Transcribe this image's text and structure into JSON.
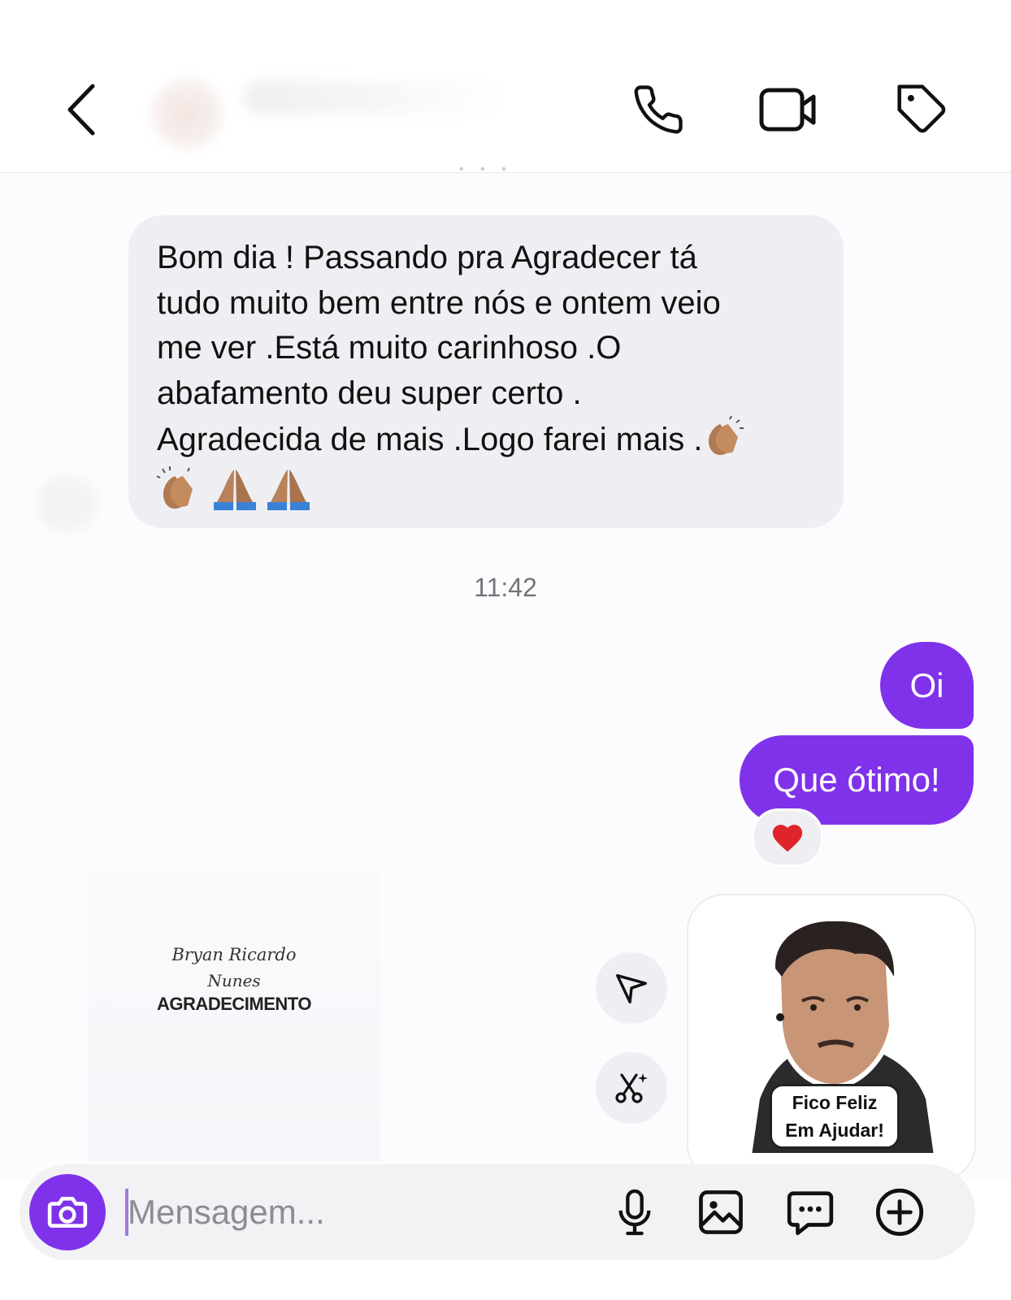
{
  "header": {
    "back_icon": "chevron-left-icon",
    "call_icon": "phone-icon",
    "video_icon": "video-camera-icon",
    "tag_icon": "tag-icon"
  },
  "messages": {
    "incoming": {
      "lines": [
        "Bom dia ! Passando pra Agradecer tá",
        "tudo muito bem entre nós e ontem veio",
        "me ver .Está muito carinhoso .O",
        "abafamento deu super certo .",
        "Agradecida de mais .Logo farei mais ."
      ],
      "emojis": [
        "clapping-hands-emoji",
        "clapping-hands-emoji",
        "folded-hands-emoji",
        "folded-hands-emoji"
      ]
    },
    "timestamp": "11:42",
    "outgoing": [
      {
        "text": "Oi"
      },
      {
        "text": "Que ótimo!",
        "reaction": "red-heart-emoji"
      }
    ],
    "incoming_sticker": {
      "line1": "Bryan Ricardo",
      "line2": "Nunes",
      "title": "AGRADECIMENTO"
    },
    "outgoing_image_sticker": {
      "caption_line1": "Fico Feliz",
      "caption_line2": "Em Ajudar!"
    }
  },
  "composer": {
    "placeholder": "Mensagem...",
    "value": ""
  },
  "colors": {
    "accent": "#7f32ea",
    "incoming_bubble": "#efeff3",
    "reaction_heart": "#e0242c"
  }
}
